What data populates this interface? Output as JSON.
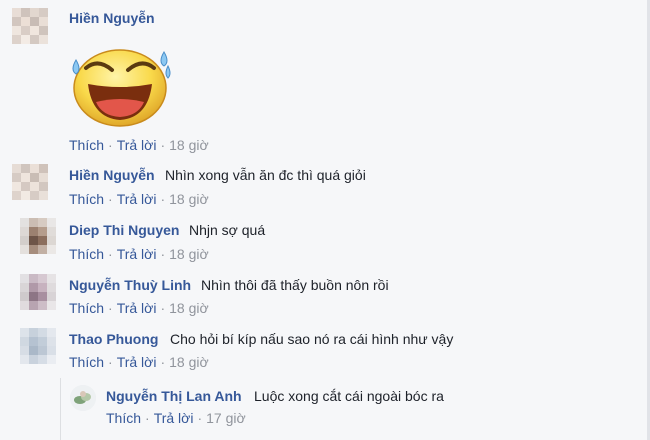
{
  "comments": [
    {
      "author": "Hiền Nguyễn",
      "text": "",
      "has_sticker": true,
      "sticker_icon": "laughing-tears-sticker",
      "actions": {
        "like": "Thích",
        "reply": "Trả lời",
        "time": "18 giờ"
      }
    },
    {
      "author": "Hiền Nguyễn",
      "text": "Nhìn xong vẫn ăn đc thì quá giỏi",
      "actions": {
        "like": "Thích",
        "reply": "Trả lời",
        "time": "18 giờ"
      }
    },
    {
      "author": "Diep Thi Nguyen",
      "text": "Nhjn sợ quá",
      "actions": {
        "like": "Thích",
        "reply": "Trả lời",
        "time": "18 giờ"
      }
    },
    {
      "author": "Nguyễn Thuỳ Linh",
      "text": "Nhìn thôi đã thấy buồn nôn rồi",
      "actions": {
        "like": "Thích",
        "reply": "Trả lời",
        "time": "18 giờ"
      }
    },
    {
      "author": "Thao Phuong",
      "text": "Cho hỏi bí kíp nấu sao nó ra cái hình như vậy",
      "actions": {
        "like": "Thích",
        "reply": "Trả lời",
        "time": "18 giờ"
      }
    }
  ],
  "reply": {
    "author": "Nguyễn Thị Lan Anh",
    "text": "Luộc xong cắt cái ngoài bóc ra",
    "actions": {
      "like": "Thích",
      "reply": "Trả lời",
      "time": "17 giờ"
    }
  },
  "colors": {
    "author": "#365899",
    "meta": "#90949c",
    "background": "#f6f7f9"
  }
}
